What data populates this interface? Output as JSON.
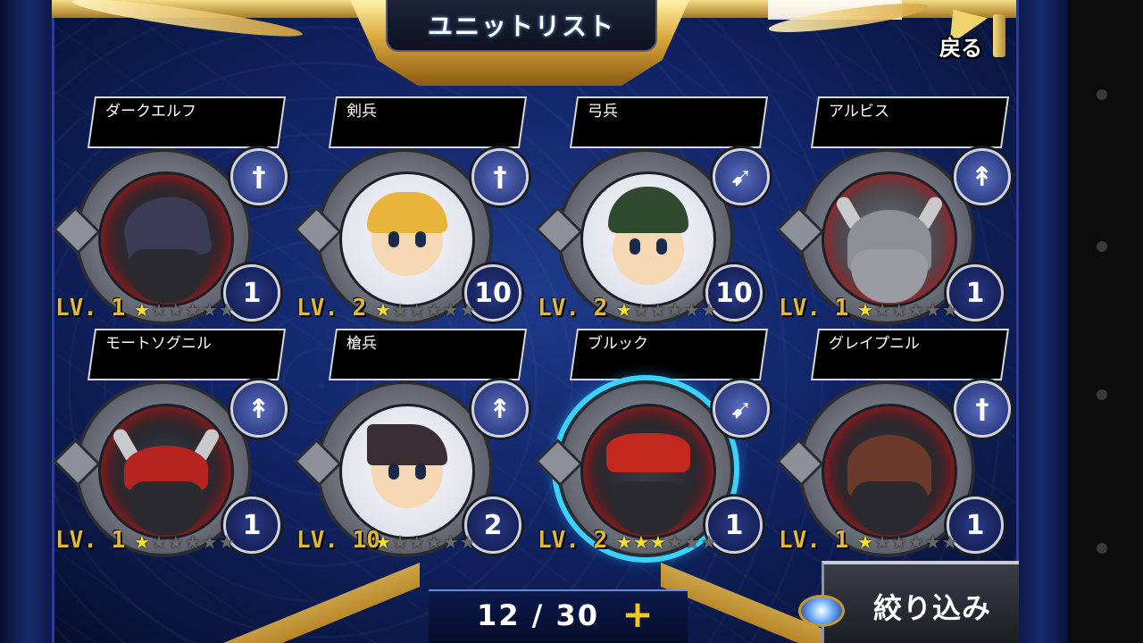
{
  "header": {
    "title": "ユニットリスト",
    "back_label": "戻る"
  },
  "units": [
    {
      "name": "ダークエルフ",
      "level": "LV. 1",
      "count": "1",
      "type_icon": "sword-icon",
      "stars_on": 1,
      "stars_total": 6
    },
    {
      "name": "剣兵",
      "level": "LV. 2",
      "count": "10",
      "type_icon": "sword-icon",
      "stars_on": 1,
      "stars_total": 6
    },
    {
      "name": "弓兵",
      "level": "LV. 2",
      "count": "10",
      "type_icon": "bow-icon",
      "stars_on": 1,
      "stars_total": 6
    },
    {
      "name": "アルビス",
      "level": "LV. 1",
      "count": "1",
      "type_icon": "spear-icon",
      "stars_on": 1,
      "stars_total": 6
    },
    {
      "name": "モートソグニル",
      "level": "LV. 1",
      "count": "1",
      "type_icon": "spear-icon",
      "stars_on": 1,
      "stars_total": 6
    },
    {
      "name": "槍兵",
      "level": "LV. 10",
      "count": "2",
      "type_icon": "spear-icon",
      "stars_on": 1,
      "stars_total": 6
    },
    {
      "name": "ブルック",
      "level": "LV. 2",
      "count": "1",
      "type_icon": "bow-icon",
      "stars_on": 3,
      "stars_total": 6
    },
    {
      "name": "グレイプニル",
      "level": "LV. 1",
      "count": "1",
      "type_icon": "sword-icon",
      "stars_on": 1,
      "stars_total": 6
    }
  ],
  "footer": {
    "counter": "12 / 30",
    "plus_label": "+",
    "filter_label": "絞り込み"
  },
  "colors": {
    "level_text": "#e0b93a",
    "star_on": "#f5e02a",
    "star_off": "#6a6a6a",
    "badge_blue": "#1c2a6d",
    "gold": "#d9a63a"
  }
}
